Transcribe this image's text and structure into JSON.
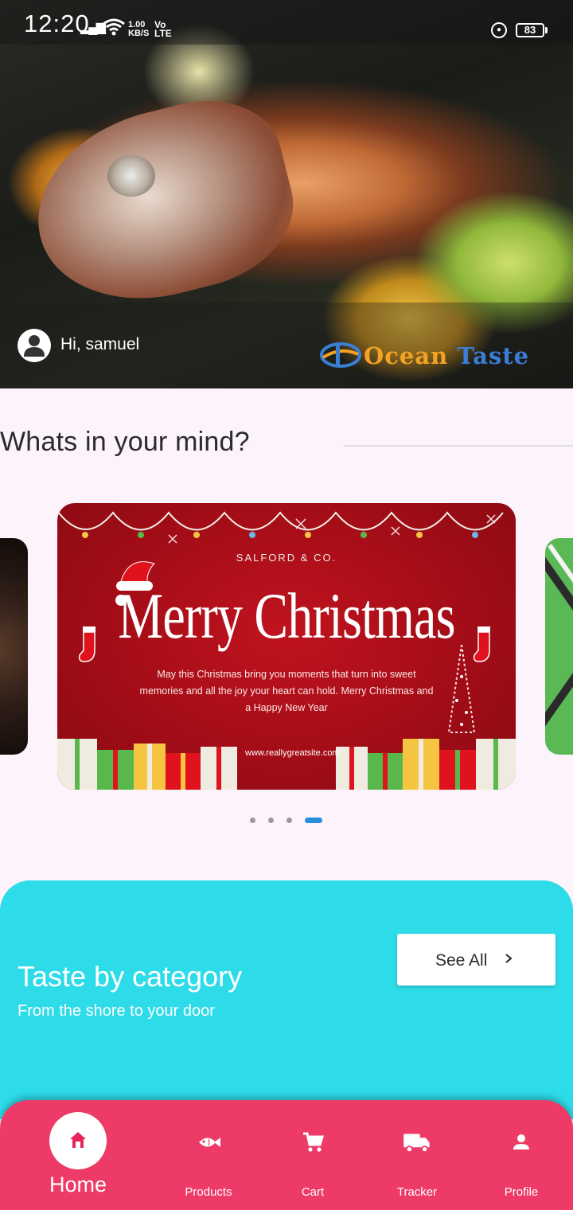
{
  "status_bar": {
    "time": "12:20",
    "speed_value": "1.00",
    "speed_unit": "KB/S",
    "network_top": "Vo",
    "network_bottom": "LTE",
    "battery": "83"
  },
  "header": {
    "greeting": "Hi, samuel",
    "logo_word1": "Ocean",
    "logo_word2": "Taste"
  },
  "mind": {
    "title": "Whats in your mind?"
  },
  "banner": {
    "brand": "SALFORD & CO.",
    "title": "Merry Christmas",
    "message": "May this Christmas bring you moments that turn into sweet memories and all the joy your heart can hold. Merry Christmas and a Happy New Year",
    "url": "www.reallygreatsite.com",
    "active_slide": 4,
    "slide_count": 4
  },
  "category": {
    "title": "Taste by category",
    "subtitle": "From the shore to your door",
    "see_all": "See All"
  },
  "nav": {
    "home": "Home",
    "products": "Products",
    "cart": "Cart",
    "tracker": "Tracker",
    "profile": "Profile",
    "active": "home"
  },
  "colors": {
    "nav_bg": "#ee3a67",
    "category_bg": "#2ddbe9",
    "dot_active": "#2a8ee0",
    "page_bg": "#fcf3fb"
  }
}
